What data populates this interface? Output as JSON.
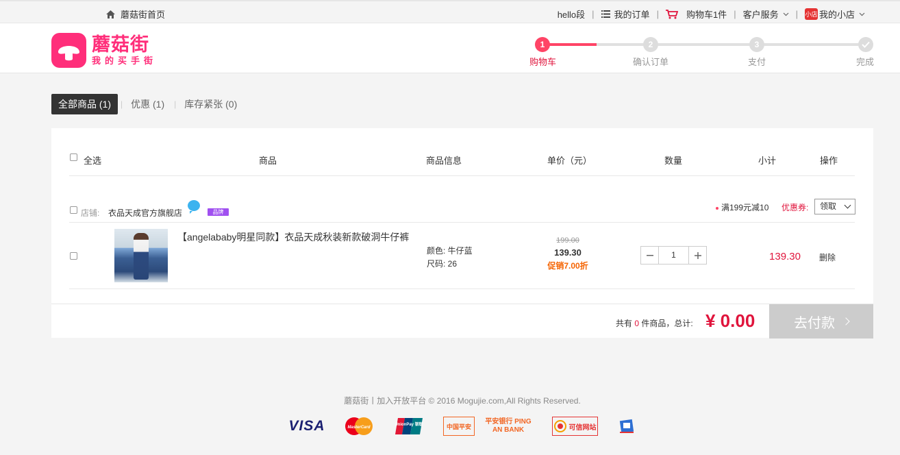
{
  "topbar": {
    "home_label": "蘑菇街首页",
    "greeting": "hello段",
    "orders_label": "我的订单",
    "cart_label": "购物车1件",
    "service_label": "客户服务",
    "shop_badge": "小店",
    "shop_label": "我的小店"
  },
  "logo": {
    "title": "蘑菇街",
    "subtitle": "我的买手街"
  },
  "steps": [
    {
      "num": "1",
      "label": "购物车"
    },
    {
      "num": "2",
      "label": "确认订单"
    },
    {
      "num": "3",
      "label": "支付"
    },
    {
      "num": "",
      "label": "完成"
    }
  ],
  "tabs": [
    {
      "label": "全部商品 (1)"
    },
    {
      "label": "优惠 (1)"
    },
    {
      "label": "库存紧张 (0)"
    }
  ],
  "table": {
    "select_all": "全选",
    "col_product": "商品",
    "col_info": "商品信息",
    "col_price": "单价（元）",
    "col_qty": "数量",
    "col_subtotal": "小计",
    "col_action": "操作"
  },
  "shop": {
    "label": "店铺:",
    "name": "衣品天成官方旗舰店",
    "brand_badge": "品牌",
    "promo": "满199元减10",
    "coupon_label": "优惠券:",
    "coupon_value": "领取"
  },
  "item": {
    "title": "【angelababy明星同款】衣品天成秋装新款破洞牛仔裤",
    "color": "颜色: 牛仔蓝",
    "size": "尺码: 26",
    "original_price": "199.00",
    "price": "139.30",
    "discount": "促销7.00折",
    "quantity": "1",
    "subtotal": "139.30",
    "delete_label": "删除"
  },
  "summary": {
    "prefix": "共有",
    "count": "0",
    "suffix": "件商品，总计:",
    "total": "¥ 0.00",
    "pay_label": "去付款"
  },
  "footer": {
    "copyright": "蘑菇街丨加入开放平台 © 2016 Mogujie.com,All Rights Reserved.",
    "logos": [
      "VISA",
      "MasterCard",
      "UnionPay 银联",
      "中国平安",
      "平安银行 PING AN BANK",
      "可信网站"
    ]
  }
}
